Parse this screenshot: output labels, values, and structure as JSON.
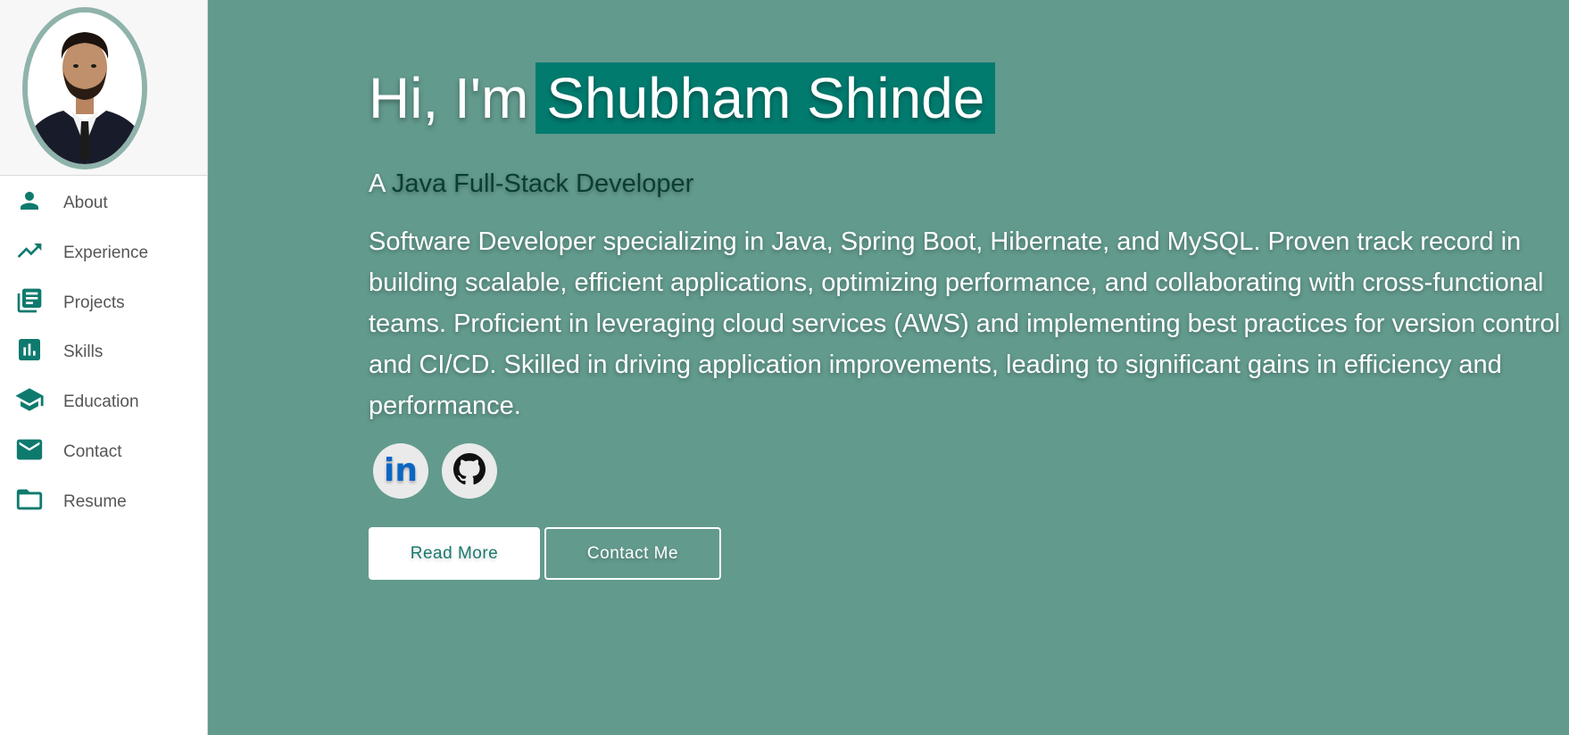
{
  "sidebar": {
    "profile_photo_alt": "Profile photo",
    "items": [
      {
        "label": "About",
        "icon": "person-icon"
      },
      {
        "label": "Experience",
        "icon": "trending-up-icon"
      },
      {
        "label": "Projects",
        "icon": "library-books-icon"
      },
      {
        "label": "Skills",
        "icon": "bar-chart-icon"
      },
      {
        "label": "Education",
        "icon": "school-icon"
      },
      {
        "label": "Contact",
        "icon": "mail-icon"
      },
      {
        "label": "Resume",
        "icon": "folder-icon"
      }
    ]
  },
  "hero": {
    "greeting": "Hi, I'm",
    "name": "Shubham Shinde",
    "subtitle_prefix": "A",
    "role": "Java Full-Stack Developer",
    "bio": "Software Developer specializing in Java, Spring Boot, Hibernate, and MySQL. Proven track record in building scalable, efficient applications, optimizing performance, and collaborating with cross-functional teams. Proficient in leveraging cloud services (AWS) and implementing best practices for version control and CI/CD. Skilled in driving application improvements, leading to significant gains in efficiency and performance.",
    "socials": [
      {
        "icon": "linkedin-icon",
        "label": "in"
      },
      {
        "icon": "github-icon"
      }
    ],
    "read_more_label": "Read More",
    "contact_me_label": "Contact Me"
  },
  "colors": {
    "accent": "#027b6f",
    "hero_background": "#629a8d",
    "sidebar_icon": "#0e7a6e"
  }
}
